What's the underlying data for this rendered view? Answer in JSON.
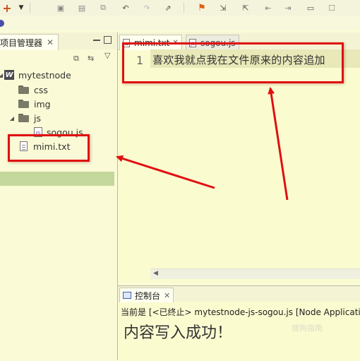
{
  "toolbar": {
    "icons": [
      "new-icon",
      "dropdown-icon",
      "save-icon",
      "save-all-icon",
      "copy-icon",
      "undo-icon",
      "redo-icon",
      "link-icon",
      "bookmark-icon",
      "import-icon",
      "export-icon",
      "prev-icon",
      "next-icon",
      "console-icon",
      "tasks-icon"
    ]
  },
  "explorer": {
    "title": "项目管理器",
    "project": "mytestnode",
    "items": [
      {
        "name": "css"
      },
      {
        "name": "img"
      },
      {
        "name": "js"
      },
      {
        "name": "sogou.js"
      },
      {
        "name": "mimi.txt"
      }
    ]
  },
  "editor": {
    "tabs": [
      {
        "label": "mimi.txt",
        "active": true
      },
      {
        "label": "sogou.js",
        "active": false
      }
    ],
    "line_number": "1",
    "line_text": "喜欢我就点我在文件原来的内容追加"
  },
  "console": {
    "tab_label": "控制台",
    "status": "当前是 [<已终止> mytestnode-js-sogou.js [Node Applicatio",
    "output": "内容写入成功！",
    "watermark": "搜狗指南"
  },
  "colors": {
    "annotation_red": "#e01010",
    "selection_green": "#c4d79c",
    "background": "#fbfbd8"
  }
}
